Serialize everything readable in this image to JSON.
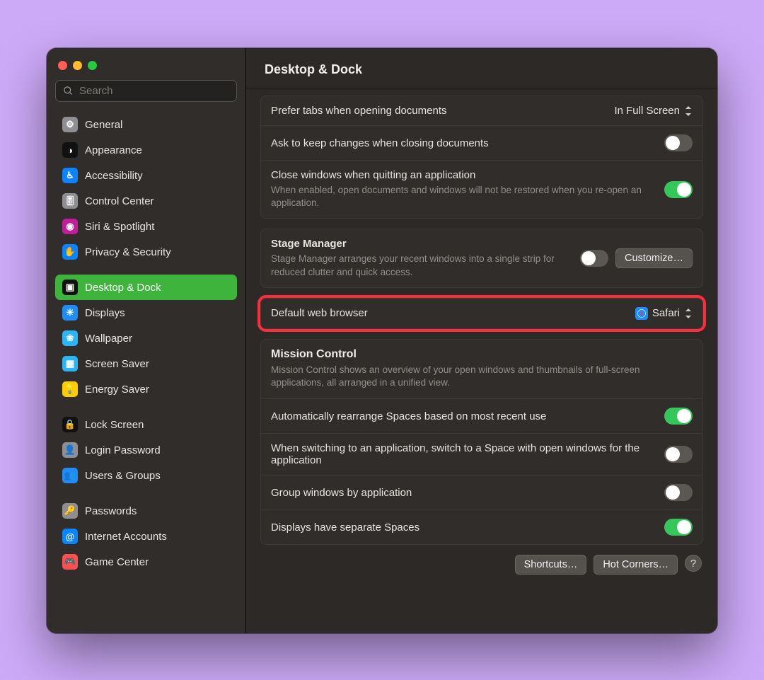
{
  "window_title": "Desktop & Dock",
  "search_placeholder": "Search",
  "sidebar": {
    "groups": [
      [
        {
          "id": "general",
          "label": "General",
          "color": "#8e8e93",
          "glyph": "⚙"
        },
        {
          "id": "appearance",
          "label": "Appearance",
          "color": "#111",
          "glyph": "◑"
        },
        {
          "id": "accessibility",
          "label": "Accessibility",
          "color": "#0a84ff",
          "glyph": "♿︎"
        },
        {
          "id": "control-center",
          "label": "Control Center",
          "color": "#8e8e93",
          "glyph": "🎚"
        },
        {
          "id": "siri",
          "label": "Siri & Spotlight",
          "color": "#c21e9a",
          "glyph": "◉"
        },
        {
          "id": "privacy",
          "label": "Privacy & Security",
          "color": "#0a84ff",
          "glyph": "✋"
        }
      ],
      [
        {
          "id": "desktop-dock",
          "label": "Desktop & Dock",
          "color": "#111",
          "glyph": "▣",
          "selected": true
        },
        {
          "id": "displays",
          "label": "Displays",
          "color": "#1f8df5",
          "glyph": "☀"
        },
        {
          "id": "wallpaper",
          "label": "Wallpaper",
          "color": "#2ab6f6",
          "glyph": "❀"
        },
        {
          "id": "screen-saver",
          "label": "Screen Saver",
          "color": "#2ab6f6",
          "glyph": "▦"
        },
        {
          "id": "energy",
          "label": "Energy Saver",
          "color": "#ffcc00",
          "glyph": "💡"
        }
      ],
      [
        {
          "id": "lock",
          "label": "Lock Screen",
          "color": "#111",
          "glyph": "🔒"
        },
        {
          "id": "login",
          "label": "Login Password",
          "color": "#8e8e93",
          "glyph": "👤"
        },
        {
          "id": "users",
          "label": "Users & Groups",
          "color": "#1f8df5",
          "glyph": "👥"
        }
      ],
      [
        {
          "id": "passwords",
          "label": "Passwords",
          "color": "#8e8e93",
          "glyph": "🔑"
        },
        {
          "id": "internet",
          "label": "Internet Accounts",
          "color": "#0a84ff",
          "glyph": "@"
        },
        {
          "id": "gamecenter",
          "label": "Game Center",
          "color": "#ff4f4f",
          "glyph": "🎮"
        }
      ]
    ]
  },
  "rows": {
    "prefer_tabs_label": "Prefer tabs when opening documents",
    "prefer_tabs_value": "In Full Screen",
    "ask_keep_label": "Ask to keep changes when closing documents",
    "ask_keep_on": false,
    "close_quit_label": "Close windows when quitting an application",
    "close_quit_sub": "When enabled, open documents and windows will not be restored when you re-open an application.",
    "close_quit_on": true,
    "stage_title": "Stage Manager",
    "stage_sub": "Stage Manager arranges your recent windows into a single strip for reduced clutter and quick access.",
    "stage_on": false,
    "customize_label": "Customize…",
    "default_browser_label": "Default web browser",
    "default_browser_value": "Safari",
    "mission_title": "Mission Control",
    "mission_sub": "Mission Control shows an overview of your open windows and thumbnails of full-screen applications, all arranged in a unified view.",
    "auto_rearrange_label": "Automatically rearrange Spaces based on most recent use",
    "auto_rearrange_on": true,
    "switch_space_label": "When switching to an application, switch to a Space with open windows for the application",
    "switch_space_on": false,
    "group_windows_label": "Group windows by application",
    "group_windows_on": false,
    "displays_spaces_label": "Displays have separate Spaces",
    "displays_spaces_on": true,
    "shortcuts_btn": "Shortcuts…",
    "hotcorners_btn": "Hot Corners…"
  }
}
